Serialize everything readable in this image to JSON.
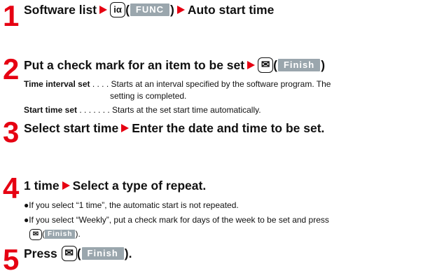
{
  "steps": [
    {
      "number": "1",
      "parts": [
        "Software list",
        "FUNC",
        "Auto start time"
      ]
    },
    {
      "number": "2",
      "parts": [
        "Put a check mark for an item to be set",
        "Finish"
      ],
      "details": [
        {
          "term": "Time interval set",
          "dots": " . . . . ",
          "text": "Starts at an interval specified by the software program. The",
          "cont": "setting is completed."
        },
        {
          "term": "Start time set",
          "dots": " . . . . . . . ",
          "text": "Starts at the set start time automatically."
        }
      ]
    },
    {
      "number": "3",
      "parts": [
        "Select start time",
        "Enter the date and time to be set."
      ]
    },
    {
      "number": "4",
      "parts": [
        "1 time",
        "Select a type of repeat."
      ],
      "bullets": [
        "If you select “1 time”, the automatic start is not repeated.",
        "If you select “Weekly”, put a check mark for days of the week to be set and press"
      ],
      "bullet_tail": "Finish",
      "bullet_tail_after": ")."
    },
    {
      "number": "5",
      "parts": [
        "Press",
        "Finish",
        ")."
      ]
    }
  ],
  "icons": {
    "menu_key": "iα",
    "mail_key": "✉"
  },
  "colors": {
    "step_number": "#e60012",
    "softkey_bg": "#9aa6ad"
  }
}
